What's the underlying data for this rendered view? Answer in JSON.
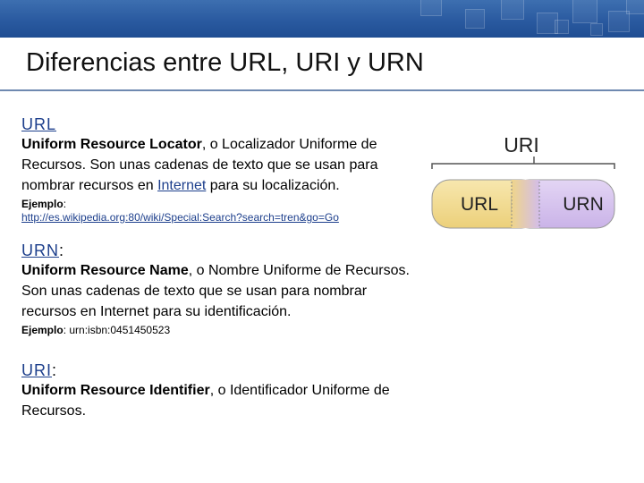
{
  "title": "Diferencias entre URL, URI y URN",
  "sections": {
    "url": {
      "heading": "URL",
      "heading_suffix": "",
      "bold_term": "Uniform Resource Locator",
      "desc_before_link": ", o Localizador Uniforme de Recursos. Son unas cadenas de texto que se usan para nombrar recursos en ",
      "desc_link": "Internet",
      "desc_after_link": " para su localización.",
      "example_label": "Ejemplo",
      "example_sep": ":",
      "example_value": "http://es.wikipedia.org:80/wiki/Special:Search?search=tren&go=Go"
    },
    "urn": {
      "heading": "URN",
      "heading_suffix": ":",
      "bold_term": "Uniform Resource Name",
      "desc": ", o Nombre Uniforme de Recursos. Son unas cadenas de texto que se usan para nombrar recursos en Internet para su identificación.",
      "example_label": "Ejemplo",
      "example_value": ": urn:isbn:0451450523"
    },
    "uri": {
      "heading": "URI",
      "heading_suffix": ":",
      "bold_term": "Uniform Resource Identifier",
      "desc": ", o Identificador Uniforme de Recursos."
    }
  },
  "diagram": {
    "uri_label": "URI",
    "url_label": "URL",
    "urn_label": "URN",
    "url_color": "#f2dd96",
    "urn_color": "#d8c6ee"
  },
  "colors": {
    "banner": "#2a5aa0",
    "link": "#1d3f8c",
    "title_rule": "#6f89b0"
  }
}
